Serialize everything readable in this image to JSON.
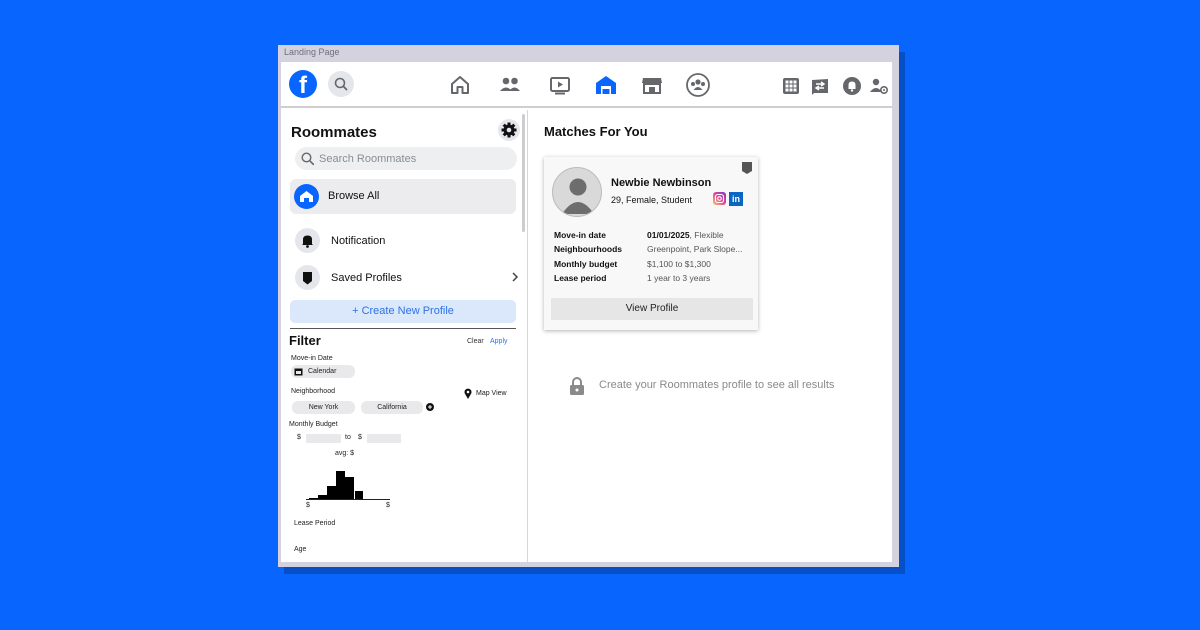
{
  "frame": {
    "title": "Landing Page"
  },
  "topbar": {
    "logo": "f",
    "icons": [
      "search-icon",
      "home-icon",
      "friends-icon",
      "watch-icon",
      "roommates-icon",
      "marketplace-icon",
      "groups-icon",
      "menu-grid-icon",
      "messenger-icon",
      "notifications-icon",
      "account-icon"
    ]
  },
  "sidebar": {
    "title": "Roommates",
    "search_placeholder": "Search Roommates",
    "browse_all": "Browse All",
    "items": [
      {
        "label": "Notification"
      },
      {
        "label": "Saved Profiles"
      }
    ],
    "create_button": "+    Create New Profile"
  },
  "filter": {
    "title": "Filter",
    "clear": "Clear",
    "apply": "Apply",
    "move_in_label": "Move-in Date",
    "calendar": "Calendar",
    "neighborhood_label": "Neighborhood",
    "map_view": "Map View",
    "neighborhoods": [
      "New York",
      "California"
    ],
    "budget_label": "Monthly Budget",
    "currency": "$",
    "to": "to",
    "avg": "avg: $",
    "hist_min": "$",
    "hist_max": "$",
    "histogram": [
      0.05,
      0.12,
      0.42,
      0.95,
      0.72,
      0.28
    ],
    "lease_label": "Lease Period",
    "age_label": "Age"
  },
  "main": {
    "title": "Matches For You",
    "card": {
      "name": "Newbie Newbinson",
      "subtitle": "29, Female, Student",
      "details": [
        {
          "label": "Move-in date",
          "value_bold": "01/01/2025",
          "value": ", Flexible"
        },
        {
          "label": "Neighbourhoods",
          "value_bold": "",
          "value": "Greenpoint, Park Slope..."
        },
        {
          "label": "Monthly budget",
          "value_bold": "",
          "value": "$1,100 to $1,300"
        },
        {
          "label": "Lease period",
          "value_bold": "",
          "value": "1 year to 3 years"
        }
      ],
      "view_button": "View Profile"
    },
    "locked_message": "Create your Roommates profile to see all results"
  },
  "colors": {
    "brand": "#0866ff",
    "link": "#2d73e6",
    "create_bg": "#dbe7fb"
  }
}
